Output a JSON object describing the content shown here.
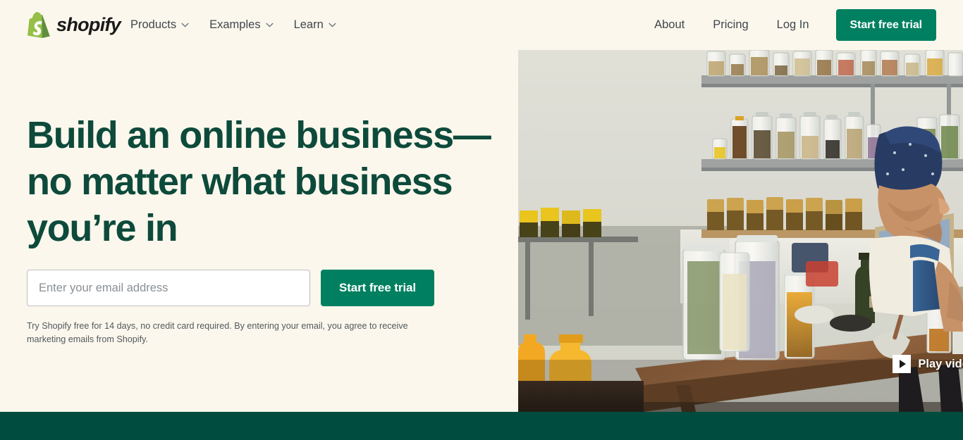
{
  "brand": {
    "name": "shopify",
    "logo_icon": "shopify-bag-icon",
    "logo_color": "#95bf47"
  },
  "header": {
    "nav_primary": [
      {
        "label": "Products",
        "icon": "chevron-down-icon"
      },
      {
        "label": "Examples",
        "icon": "chevron-down-icon"
      },
      {
        "label": "Learn",
        "icon": "chevron-down-icon"
      }
    ],
    "nav_secondary": [
      {
        "label": "About"
      },
      {
        "label": "Pricing"
      },
      {
        "label": "Log In"
      }
    ],
    "cta_label": "Start free trial"
  },
  "hero": {
    "title": "Build an online business—no matter what business you’re in",
    "email_placeholder": "Enter your email address",
    "email_value": "",
    "cta_label": "Start free trial",
    "disclaimer": "Try Shopify free for 14 days, no credit card required. By entering your email, you agree to receive marketing emails from Shopify.",
    "play_video_label": "Play video",
    "play_icon": "play-triangle-icon",
    "image_alt": "Woman in a blue head wrap working on a laptop at a wooden table surrounded by glass jars of dried herbs and spices on metal shelves"
  },
  "colors": {
    "background": "#fbf7ec",
    "heading": "#0d4a3b",
    "button": "#008060",
    "bottom_band": "#004c3f",
    "nav_text": "#41474e"
  }
}
